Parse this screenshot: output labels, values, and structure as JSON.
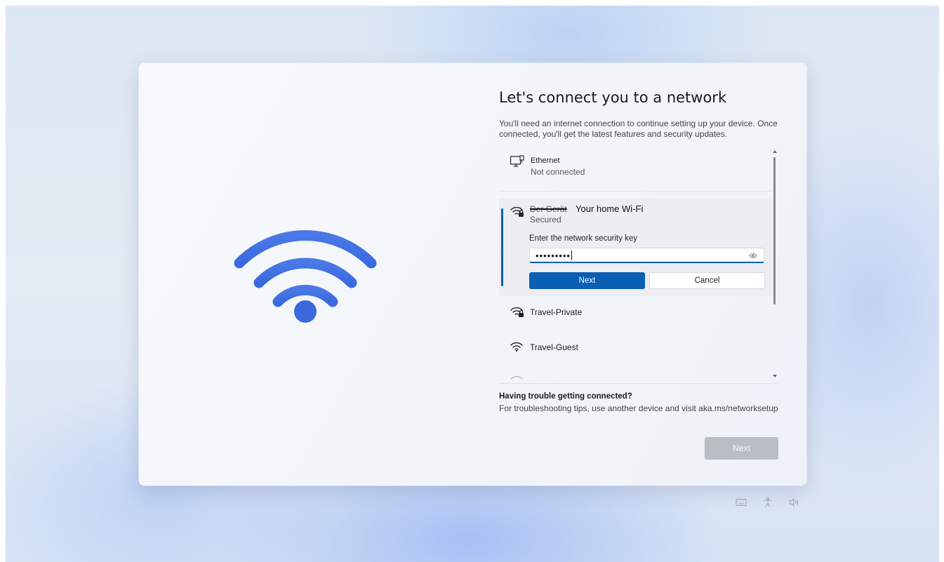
{
  "header": {
    "title": "Let's connect you to a network",
    "subtitle": "You'll need an internet connection to continue setting up your device. Once connected, you'll get the latest features and security updates."
  },
  "networks": {
    "ethernet": {
      "name": "Ethernet",
      "status": "Not connected",
      "icon": "ethernet-monitor-icon"
    },
    "selected": {
      "struck_name": "Der Gerät",
      "annotation": "Your home Wi-Fi",
      "status": "Secured",
      "icon": "wifi-secured-icon",
      "key_label": "Enter the network security key",
      "key_value": "•••••••••",
      "next_label": "Next",
      "cancel_label": "Cancel"
    },
    "others": [
      {
        "name": "Travel-Private",
        "icon": "wifi-secured-icon"
      },
      {
        "name": "Travel-Guest",
        "icon": "wifi-open-icon"
      }
    ]
  },
  "help": {
    "title": "Having trouble getting connected?",
    "text": "For troubleshooting tips, use another device and visit aka.ms/networksetup"
  },
  "footer": {
    "next_label": "Next"
  },
  "tray_icons": [
    "keyboard-icon",
    "accessibility-icon",
    "volume-icon"
  ],
  "colors": {
    "accent": "#0a5fb4",
    "wifi_art": "#3f73e0",
    "disabled_button": "#b9bdc4"
  }
}
